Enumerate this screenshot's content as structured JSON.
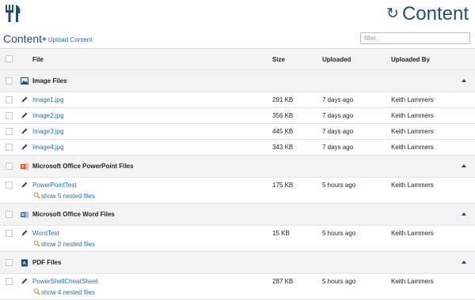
{
  "app": {
    "title": "Content",
    "logo_icon": "fork-knife-icon",
    "title_icon": "sync-icon"
  },
  "content_header": {
    "title": "Content",
    "upload_label": "Upload Content",
    "filter_placeholder": "filter..."
  },
  "columns": {
    "file": "File",
    "size": "Size",
    "uploaded": "Uploaded",
    "uploaded_by": "Uploaded By"
  },
  "groups": [
    {
      "name": "Image Files",
      "icon": "image-icon",
      "items": [
        {
          "file": "Image1.jpg",
          "size": "291 KB",
          "uploaded": "7 days ago",
          "by": "Keith Lammers"
        },
        {
          "file": "Image2.jpg",
          "size": "356 KB",
          "uploaded": "7 days ago",
          "by": "Keith Lammers"
        },
        {
          "file": "Image3.jpg",
          "size": "445 KB",
          "uploaded": "7 days ago",
          "by": "Keith Lammers"
        },
        {
          "file": "Image4.jpg",
          "size": "343 KB",
          "uploaded": "7 days ago",
          "by": "Keith Lammers"
        }
      ]
    },
    {
      "name": "Microsoft Office PowerPoint Files",
      "icon": "powerpoint-icon",
      "items": [
        {
          "file": "PowerPointTest",
          "size": "175 KB",
          "uploaded": "5 hours ago",
          "by": "Keith Lammers",
          "nested": "show 5 nested files"
        }
      ]
    },
    {
      "name": "Microsoft Office Word Files",
      "icon": "word-icon",
      "items": [
        {
          "file": "WordTest",
          "size": "15 KB",
          "uploaded": "5 hours ago",
          "by": "Keith Lammers",
          "nested": "show 2 nested files"
        }
      ]
    },
    {
      "name": "PDF Files",
      "icon": "pdf-icon",
      "items": [
        {
          "file": "PowerShellCheatSheet",
          "size": "287 KB",
          "uploaded": "5 hours ago",
          "by": "Keith Lammers",
          "nested": "show 4 nested files"
        }
      ]
    }
  ],
  "colors": {
    "accent": "#1e4f6e",
    "link": "#2b6fa3",
    "header_bg": "#f3f3f3",
    "powerpoint": "#d24726",
    "word": "#2b579a",
    "pdf": "#1e4f6e"
  }
}
